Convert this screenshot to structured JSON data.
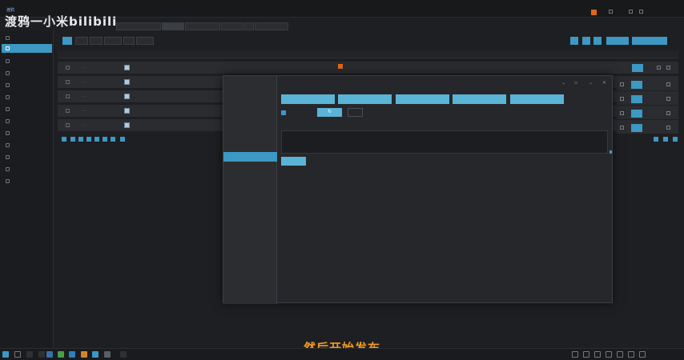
{
  "watermark": {
    "main": "渡鸦一小米bilibili",
    "small": "渡鸦"
  },
  "topbar": {
    "items": [
      "",
      "",
      "",
      "",
      "",
      ""
    ],
    "user": ""
  },
  "tabs": [
    {
      "label": ""
    },
    {
      "label": ""
    },
    {
      "label": ""
    },
    {
      "label": ""
    },
    {
      "label": ""
    },
    {
      "label": ""
    }
  ],
  "sidebar": {
    "items": [
      {
        "label": ""
      },
      {
        "label": ""
      },
      {
        "label": ""
      },
      {
        "label": ""
      },
      {
        "label": ""
      },
      {
        "label": ""
      },
      {
        "label": ""
      },
      {
        "label": ""
      },
      {
        "label": ""
      },
      {
        "label": ""
      },
      {
        "label": ""
      },
      {
        "label": ""
      },
      {
        "label": ""
      }
    ],
    "active_index": 1
  },
  "toolbar": {
    "buttons": [
      {
        "label": ""
      },
      {
        "label": ""
      },
      {
        "label": ""
      },
      {
        "label": ""
      },
      {
        "label": ""
      },
      {
        "label": ""
      }
    ]
  },
  "table": {
    "headers": [
      "",
      "",
      "",
      "",
      "",
      ""
    ],
    "row_count": 5
  },
  "modal": {
    "title": "",
    "side_items": [
      {
        "label": ""
      },
      {
        "label": ""
      },
      {
        "label": ""
      },
      {
        "label": ""
      },
      {
        "label": ""
      },
      {
        "label": ""
      },
      {
        "label": ""
      }
    ],
    "side_active_index": 5,
    "action_buttons": [
      {
        "label": ""
      },
      {
        "label": ""
      },
      {
        "label": ""
      },
      {
        "label": ""
      },
      {
        "label": ""
      }
    ],
    "checkbox_label": "",
    "extra_button": "",
    "log_label": "",
    "log_lines": [
      "",
      "",
      "",
      "",
      ""
    ]
  },
  "subtitle": "然后开始发布",
  "taskbar": {
    "clock_time": "",
    "clock_date": ""
  },
  "colors": {
    "accent": "#3d98c4",
    "accent_light": "#5ab4d6",
    "orange": "#e0661b",
    "subtitle": "#f29a1f"
  }
}
